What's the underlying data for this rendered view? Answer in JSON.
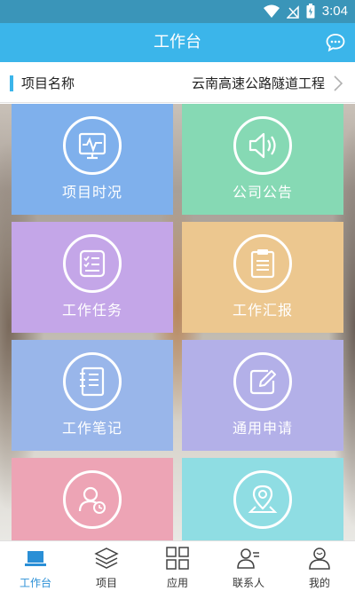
{
  "status_bar": {
    "time": "3:04",
    "icons": [
      "wifi-icon",
      "no-signal-icon",
      "battery-icon"
    ]
  },
  "app_bar": {
    "title": "工作台",
    "right_icon": "chat-icon"
  },
  "project": {
    "label": "项目名称",
    "value": "云南高速公路隧道工程"
  },
  "tiles": [
    {
      "label": "项目时况",
      "icon": "monitor-pulse-icon",
      "color": "#7fb0ec"
    },
    {
      "label": "公司公告",
      "icon": "speaker-icon",
      "color": "#86d9b4"
    },
    {
      "label": "工作任务",
      "icon": "task-list-icon",
      "color": "#c4a6e8"
    },
    {
      "label": "工作汇报",
      "icon": "clipboard-icon",
      "color": "#ecc78f"
    },
    {
      "label": "工作笔记",
      "icon": "notebook-icon",
      "color": "#99b6ea"
    },
    {
      "label": "通用申请",
      "icon": "edit-icon",
      "color": "#b3b0e8"
    },
    {
      "label": "",
      "icon": "user-clock-icon",
      "color": "#eda4b5"
    },
    {
      "label": "",
      "icon": "map-pin-icon",
      "color": "#8fdde3"
    }
  ],
  "bottom_nav": [
    {
      "label": "工作台",
      "icon": "laptop-icon",
      "active": true
    },
    {
      "label": "项目",
      "icon": "layers-icon",
      "active": false
    },
    {
      "label": "应用",
      "icon": "grid-icon",
      "active": false
    },
    {
      "label": "联系人",
      "icon": "contact-icon",
      "active": false
    },
    {
      "label": "我的",
      "icon": "profile-icon",
      "active": false
    }
  ],
  "colors": {
    "status_bar": "#3a95b9",
    "app_bar": "#3bb5ea",
    "accent": "#2a8fd6"
  }
}
